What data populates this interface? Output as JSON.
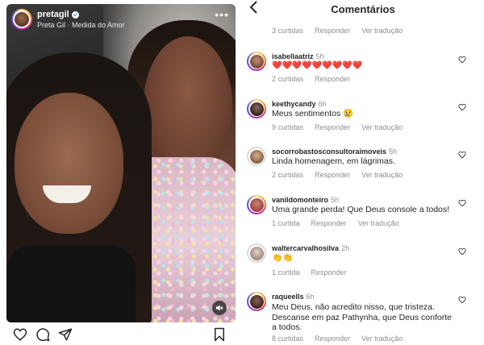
{
  "story": {
    "username": "pretagil",
    "subtitle": "Preta Gil · Medida do Amor",
    "more_icon": "more-horizontal-icon",
    "mute_icon": "sound-off-icon"
  },
  "post_actions": {
    "icons": [
      "heart-outline-icon",
      "comment-icon",
      "share-icon",
      "bookmark-icon"
    ]
  },
  "comments_panel": {
    "title": "Comentários",
    "back_icon": "chevron-left-icon",
    "first_meta": {
      "likes": "3 curtidas",
      "reply": "Responder",
      "translate": "Ver tradução"
    },
    "comments": [
      {
        "user": "isabellaatriz",
        "time": "5h",
        "text": "❤️❤️❤️❤️❤️❤️❤️❤️❤️",
        "likes": "2 curtidas",
        "reply": "Responder",
        "translate": ""
      },
      {
        "user": "keethycandy",
        "time": "6h",
        "text": "Meus sentimentos 😢",
        "likes": "9 curtidas",
        "reply": "Responder",
        "translate": "Ver tradução"
      },
      {
        "user": "socorrobastosconsultoraimoveis",
        "time": "5h",
        "text": "Linda homenagem, em lágrimas.",
        "likes": "2 curtidas",
        "reply": "Responder",
        "translate": "Ver tradução"
      },
      {
        "user": "vanildomonteiro",
        "time": "5h",
        "text": "Uma grande perda! Que Deus console a todos!",
        "likes": "1 curtida",
        "reply": "Responder",
        "translate": "Ver tradução"
      },
      {
        "user": "waltercarvalhosilva",
        "time": "2h",
        "text": "👏👏",
        "likes": "1 curtida",
        "reply": "Responder",
        "translate": ""
      },
      {
        "user": "raqueells",
        "time": "6h",
        "text": "Meu Deus, não acredito nisso, que tristeza. Descanse em paz Pathynha, que Deus conforte a todos.",
        "likes": "8 curtidas",
        "reply": "Responder",
        "translate": "Ver tradução"
      }
    ]
  },
  "colors": {
    "text": "#262626",
    "muted": "#8e8e8e",
    "heart_red": "#ed4956"
  }
}
